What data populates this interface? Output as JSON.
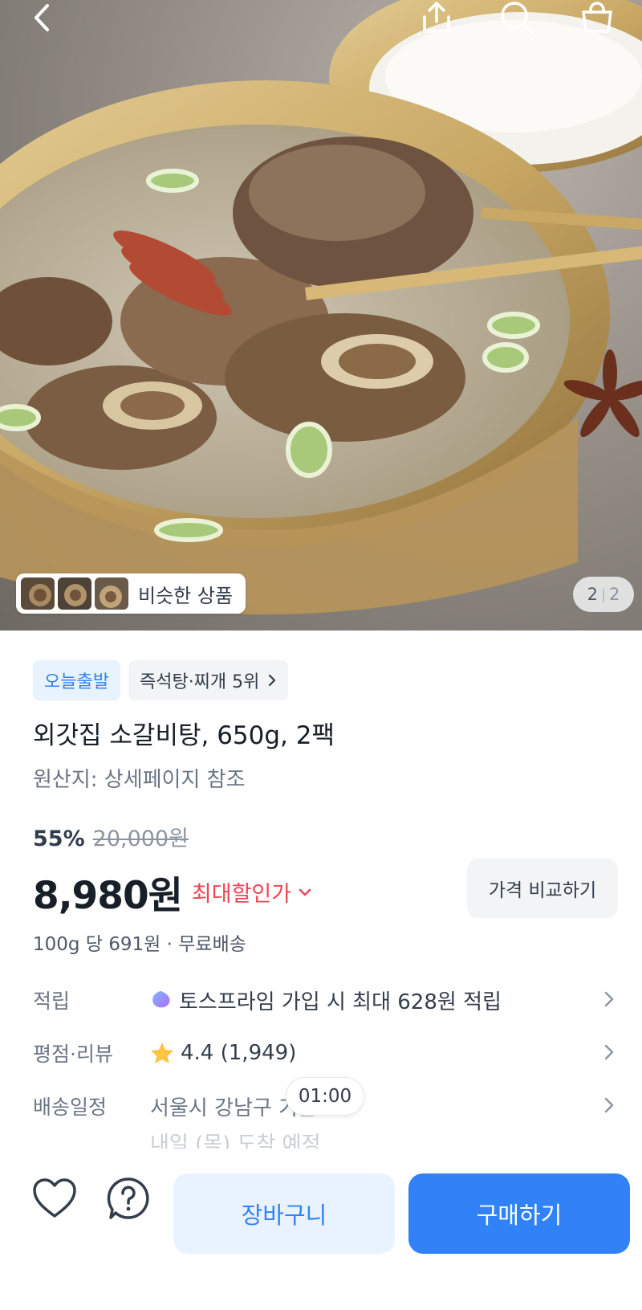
{
  "hero": {
    "similar_label": "비슷한 상품",
    "page_current": "2",
    "page_total": "2",
    "nav_icons": [
      "back-icon",
      "share-icon",
      "search-icon",
      "cart-icon"
    ]
  },
  "tags": {
    "today_ship": "오늘출발",
    "ranking": "즉석탕·찌개 5위"
  },
  "product": {
    "title": "외갓집 소갈비탕, 650g, 2팩",
    "origin": "원산지: 상세페이지 참조",
    "discount_rate": "55%",
    "original_price": "20,000원",
    "price": "8,980원",
    "max_discount_label": "최대할인가",
    "compare_label": "가격 비교하기",
    "unit_info": "100g 당 691원 · 무료배송"
  },
  "info": {
    "points_label": "적립",
    "points_value": "토스프라임 가입 시 최대 628원 적립",
    "rating_label": "평점·리뷰",
    "rating_value": "4.4 (1,949)",
    "delivery_label": "배송일정",
    "delivery_value": "서울시 강남구 기준",
    "delivery_sub": "내일 (목) 도착 예정",
    "toast_time": "01:00"
  },
  "bottom": {
    "cart_label": "장바구니",
    "buy_label": "구매하기"
  },
  "colors": {
    "accent": "#3182f6",
    "accent_light": "#e8f3ff",
    "discount_red": "#f04452",
    "star": "#ffc342"
  }
}
